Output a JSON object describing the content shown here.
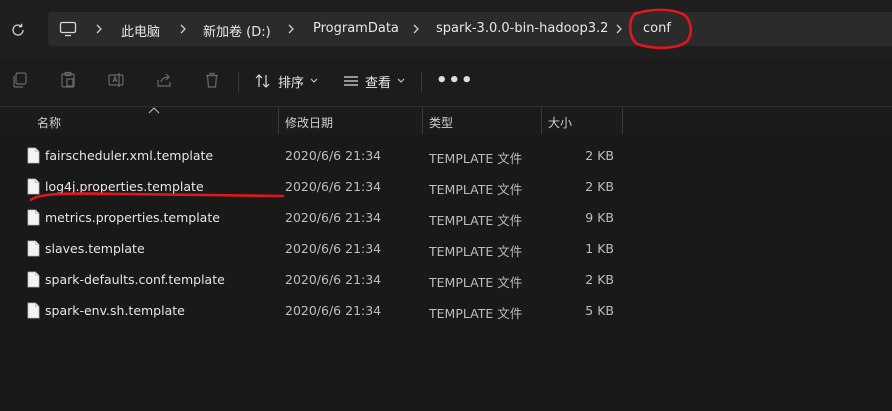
{
  "address_bar": {
    "breadcrumbs": [
      "此电脑",
      "新加卷 (D:)",
      "ProgramData",
      "spark-3.0.0-bin-hadoop3.2",
      "conf"
    ]
  },
  "toolbar": {
    "sort_label": "排序",
    "view_label": "查看",
    "more_label": "•••"
  },
  "columns": {
    "name": "名称",
    "date": "修改日期",
    "type": "类型",
    "size": "大小"
  },
  "files": [
    {
      "name": "fairscheduler.xml.template",
      "date": "2020/6/6 21:34",
      "type": "TEMPLATE 文件",
      "size": "2 KB"
    },
    {
      "name": "log4j.properties.template",
      "date": "2020/6/6 21:34",
      "type": "TEMPLATE 文件",
      "size": "2 KB"
    },
    {
      "name": "metrics.properties.template",
      "date": "2020/6/6 21:34",
      "type": "TEMPLATE 文件",
      "size": "9 KB"
    },
    {
      "name": "slaves.template",
      "date": "2020/6/6 21:34",
      "type": "TEMPLATE 文件",
      "size": "1 KB"
    },
    {
      "name": "spark-defaults.conf.template",
      "date": "2020/6/6 21:34",
      "type": "TEMPLATE 文件",
      "size": "2 KB"
    },
    {
      "name": "spark-env.sh.template",
      "date": "2020/6/6 21:34",
      "type": "TEMPLATE 文件",
      "size": "5 KB"
    }
  ],
  "colors": {
    "background": "#191919",
    "annotation_red": "#e0181e"
  }
}
